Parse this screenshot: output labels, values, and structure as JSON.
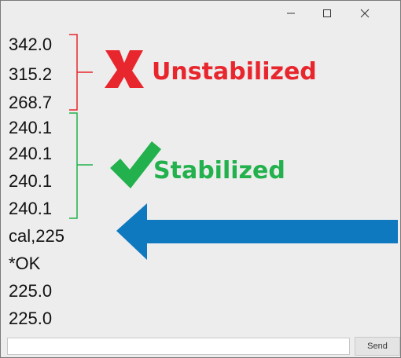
{
  "window": {
    "controls": {
      "minimize_icon": "minimize-icon",
      "maximize_icon": "maximize-icon",
      "close_icon": "close-icon"
    }
  },
  "console": {
    "lines": [
      "342.0",
      "315.2",
      "268.7",
      "240.1",
      "240.1",
      "240.1",
      "240.1",
      "cal,225",
      "*OK",
      "225.0",
      "225.0"
    ]
  },
  "annotations": {
    "unstabilized": {
      "label": "Unstabilized",
      "icon": "x-mark-icon",
      "color": "#e8262d"
    },
    "stabilized": {
      "label": "Stabilized",
      "icon": "checkmark-icon",
      "color": "#22b14c"
    },
    "arrow": {
      "icon": "left-arrow-icon",
      "color": "#0f79c0"
    }
  },
  "input_bar": {
    "value": "",
    "send_label": "Send"
  }
}
